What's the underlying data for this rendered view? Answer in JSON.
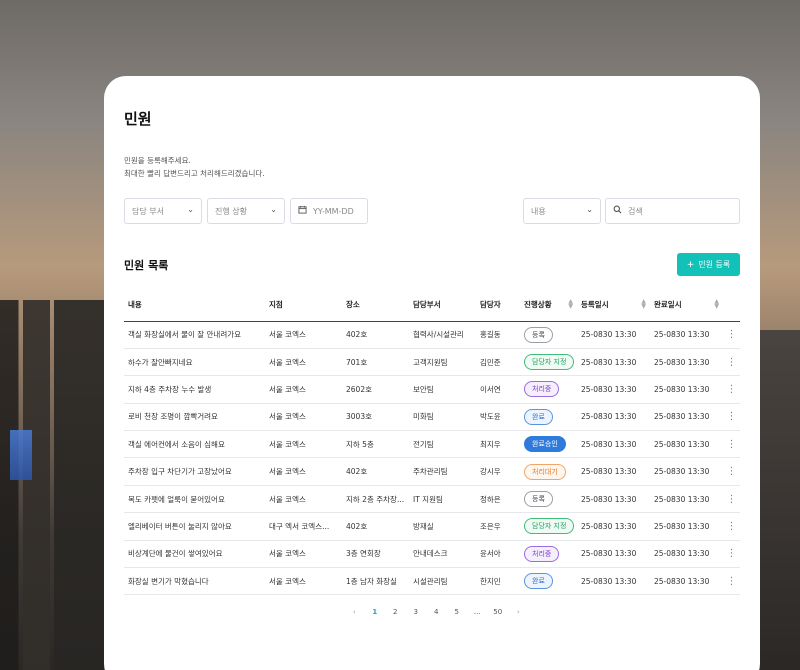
{
  "page": {
    "title": "민원",
    "description": [
      "민원을 등록해주세요.",
      "최대한 빨리 답변드리고 처리해드리겠습니다."
    ]
  },
  "filters": {
    "department": "담당 부서",
    "status": "진행 상황",
    "date": "YY-MM-DD",
    "search_type": "내용",
    "search_placeholder": "검색"
  },
  "list": {
    "title": "민원 목록",
    "add_button": "민원 등록"
  },
  "table": {
    "columns": [
      "내용",
      "지점",
      "장소",
      "담당부서",
      "담당자",
      "진행상황",
      "등록일시",
      "완료일시"
    ],
    "rows": [
      {
        "content": "객실 화장실에서 물이 잘 안내려가요",
        "branch": "서울 코엑스",
        "place": "402호",
        "dept": "협력사/시설관리",
        "manager": "홍길동",
        "status": "등록",
        "status_type": "reg",
        "reg": "25-0830 13:30",
        "done": "25-0830 13:30"
      },
      {
        "content": "하수가 잘안빠지네요",
        "branch": "서울 코엑스",
        "place": "701호",
        "dept": "고객지원팀",
        "manager": "김민준",
        "status": "담당자 지정",
        "status_type": "assign",
        "reg": "25-0830 13:30",
        "done": "25-0830 13:30"
      },
      {
        "content": "지하 4층 주차장 누수 발생",
        "branch": "서울 코엑스",
        "place": "2602호",
        "dept": "보안팀",
        "manager": "이서연",
        "status": "처리중",
        "status_type": "proc",
        "reg": "25-0830 13:30",
        "done": "25-0830 13:30"
      },
      {
        "content": "로비 천장 조명이 깜빡거려요",
        "branch": "서울 코엑스",
        "place": "3003호",
        "dept": "미화팀",
        "manager": "박도윤",
        "status": "완료",
        "status_type": "done",
        "reg": "25-0830 13:30",
        "done": "25-0830 13:30"
      },
      {
        "content": "객실 에어컨에서 소음이 심해요",
        "branch": "서울 코엑스",
        "place": "지하 5층",
        "dept": "전기팀",
        "manager": "최지우",
        "status": "완료승인",
        "status_type": "approved",
        "reg": "25-0830 13:30",
        "done": "25-0830 13:30"
      },
      {
        "content": "주차장 입구 차단기가 고장났어요",
        "branch": "서울 코엑스",
        "place": "402호",
        "dept": "주차관리팀",
        "manager": "강시우",
        "status": "처리대기",
        "status_type": "wait",
        "reg": "25-0830 13:30",
        "done": "25-0830 13:30"
      },
      {
        "content": "복도 카펫에 얼룩이 묻어있어요",
        "branch": "서울 코엑스",
        "place": "지하 2층 주차장...",
        "dept": "IT 지원팀",
        "manager": "정하은",
        "status": "등록",
        "status_type": "reg",
        "reg": "25-0830 13:30",
        "done": "25-0830 13:30"
      },
      {
        "content": "엘리베이터 버튼이 눌리지 않아요",
        "branch": "대구 엑서 코엑스...",
        "place": "402호",
        "dept": "방재실",
        "manager": "조은우",
        "status": "담당자 지정",
        "status_type": "assign",
        "reg": "25-0830 13:30",
        "done": "25-0830 13:30"
      },
      {
        "content": "비상계단에 물건이 쌓여있어요",
        "branch": "서울 코엑스",
        "place": "3층 연회장",
        "dept": "안내데스크",
        "manager": "윤서아",
        "status": "처리중",
        "status_type": "proc",
        "reg": "25-0830 13:30",
        "done": "25-0830 13:30"
      },
      {
        "content": "화장실 변기가 막혔습니다",
        "branch": "서울 코엑스",
        "place": "1층 남자 화장실",
        "dept": "시설관리팀",
        "manager": "한지민",
        "status": "완료",
        "status_type": "done",
        "reg": "25-0830 13:30",
        "done": "25-0830 13:30"
      }
    ]
  },
  "pagination": {
    "prev": "‹",
    "pages": [
      "1",
      "2",
      "3",
      "4",
      "5",
      "...",
      "50"
    ],
    "current": "1",
    "next": "›"
  }
}
